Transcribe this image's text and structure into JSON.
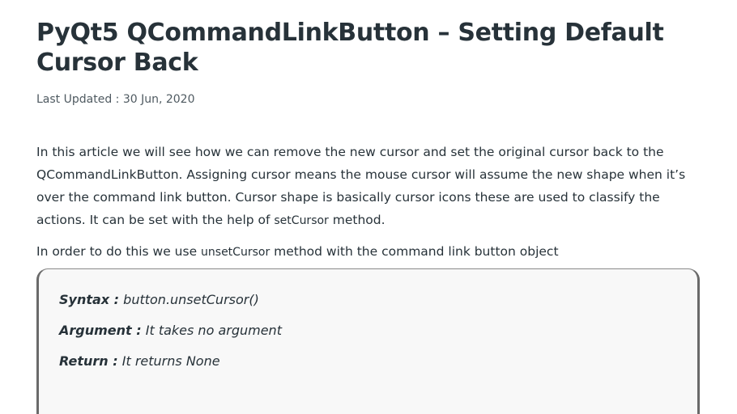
{
  "article": {
    "title": "PyQt5 QCommandLinkButton – Setting Default Cursor Back",
    "last_updated": "Last Updated : 30 Jun, 2020",
    "p1_text1": "In this article we will see how we can remove the new cursor and set the original cursor back to the QCommandLinkButton. Assigning cursor means the mouse cursor will assume the new shape when it’s over the command link button. Cursor shape is basically cursor icons these are used to classify the actions. It can be set with the help of ",
    "p1_code": "setCursor",
    "p1_text2": " method.",
    "p2_text1": "In order to do this we use ",
    "p2_code": "unsetCursor",
    "p2_text2": " method with the command link button object"
  },
  "syntax_box": {
    "syntax_label": "Syntax :",
    "syntax_value": " button.unsetCursor()",
    "argument_label": "Argument :",
    "argument_value": " It takes no argument",
    "return_label": "Return :",
    "return_value": " It returns None"
  }
}
